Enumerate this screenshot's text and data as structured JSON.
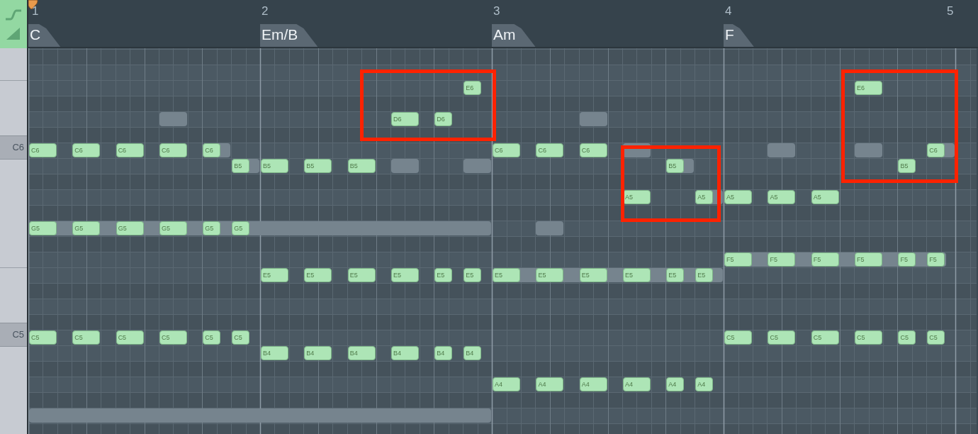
{
  "header": {
    "bars": [
      {
        "label": "1"
      },
      {
        "label": "2"
      },
      {
        "label": "3"
      },
      {
        "label": "4"
      },
      {
        "label": "5"
      }
    ],
    "chords": [
      {
        "label": "C"
      },
      {
        "label": "Em/B"
      },
      {
        "label": "Am"
      },
      {
        "label": "F"
      }
    ]
  },
  "keyboard": {
    "keys": [
      {
        "label": "C6"
      },
      {
        "label": "C5"
      }
    ]
  },
  "notes": [
    {
      "label": "C6"
    },
    {
      "label": "C6"
    },
    {
      "label": "C6"
    },
    {
      "label": "C6"
    },
    {
      "label": "C6"
    },
    {
      "label": "B5"
    },
    {
      "label": "G5"
    },
    {
      "label": "G5"
    },
    {
      "label": "G5"
    },
    {
      "label": "G5"
    },
    {
      "label": "G5"
    },
    {
      "label": "G5"
    },
    {
      "label": "C5"
    },
    {
      "label": "C5"
    },
    {
      "label": "C5"
    },
    {
      "label": "C5"
    },
    {
      "label": "C5"
    },
    {
      "label": "C5"
    },
    {
      "label": "B5"
    },
    {
      "label": "B5"
    },
    {
      "label": "B5"
    },
    {
      "label": "D6"
    },
    {
      "label": "D6"
    },
    {
      "label": "E6"
    },
    {
      "label": "E5"
    },
    {
      "label": "E5"
    },
    {
      "label": "E5"
    },
    {
      "label": "E5"
    },
    {
      "label": "E5"
    },
    {
      "label": "E5"
    },
    {
      "label": "B4"
    },
    {
      "label": "B4"
    },
    {
      "label": "B4"
    },
    {
      "label": "B4"
    },
    {
      "label": "B4"
    },
    {
      "label": "B4"
    },
    {
      "label": "C6"
    },
    {
      "label": "C6"
    },
    {
      "label": "C6"
    },
    {
      "label": "A5"
    },
    {
      "label": "B5"
    },
    {
      "label": "A5"
    },
    {
      "label": "E5"
    },
    {
      "label": "E5"
    },
    {
      "label": "E5"
    },
    {
      "label": "E5"
    },
    {
      "label": "E5"
    },
    {
      "label": "E5"
    },
    {
      "label": "A4"
    },
    {
      "label": "A4"
    },
    {
      "label": "A4"
    },
    {
      "label": "A4"
    },
    {
      "label": "A4"
    },
    {
      "label": "A4"
    },
    {
      "label": "A5"
    },
    {
      "label": "A5"
    },
    {
      "label": "A5"
    },
    {
      "label": "E6"
    },
    {
      "label": "B5"
    },
    {
      "label": "C6"
    },
    {
      "label": "F5"
    },
    {
      "label": "F5"
    },
    {
      "label": "F5"
    },
    {
      "label": "F5"
    },
    {
      "label": "F5"
    },
    {
      "label": "F5"
    },
    {
      "label": "C5"
    },
    {
      "label": "C5"
    },
    {
      "label": "C5"
    },
    {
      "label": "C5"
    },
    {
      "label": "C5"
    },
    {
      "label": "C5"
    }
  ],
  "highlights": [
    {
      "color": "#ff2200"
    },
    {
      "color": "#ff2200"
    },
    {
      "color": "#ff2200"
    }
  ]
}
